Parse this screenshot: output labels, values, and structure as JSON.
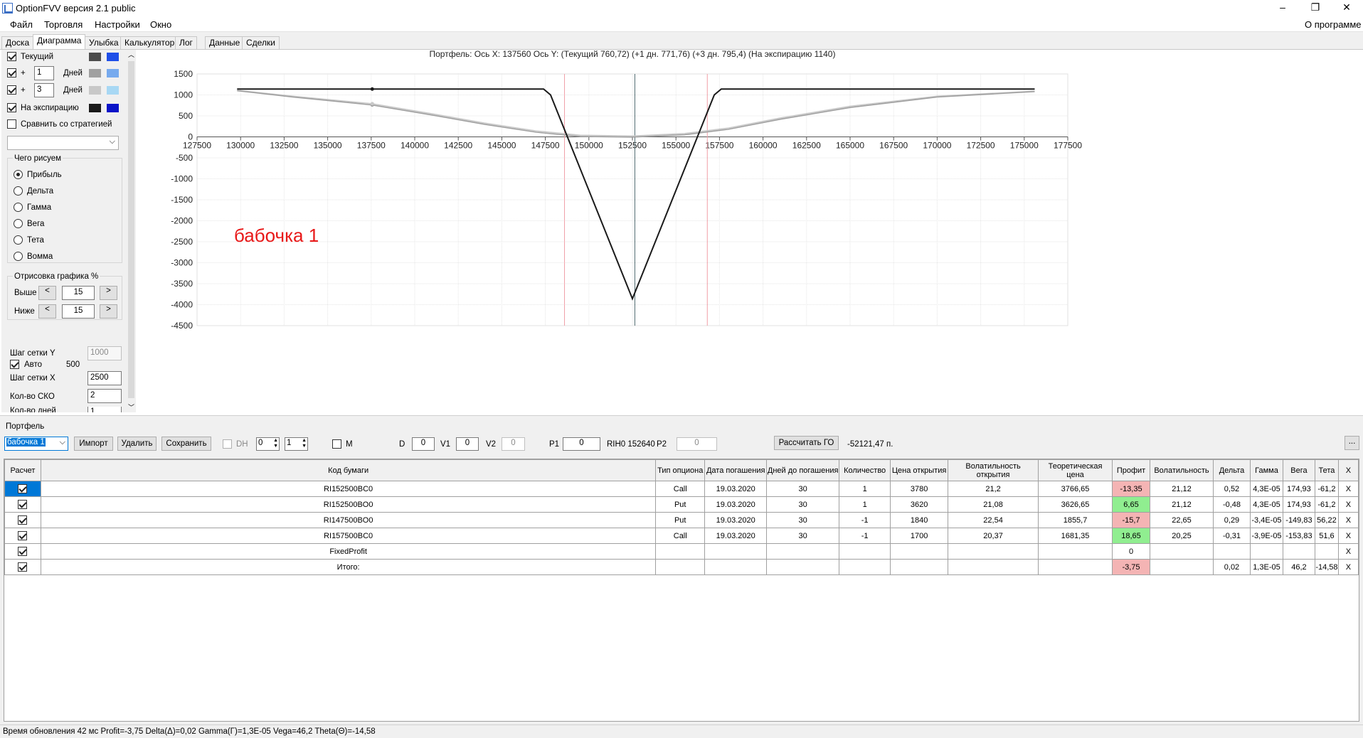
{
  "window": {
    "title": "OptionFVV версия 2.1 public",
    "minimize": "–",
    "maximize": "❐",
    "close": "✕"
  },
  "menu": {
    "items": [
      "Файл",
      "Торговля",
      "Настройки",
      "Окно"
    ],
    "about": "О программе"
  },
  "tabs": [
    "Доска",
    "Диаграмма",
    "Улыбка",
    "Калькулятор",
    "Лог",
    "Данные",
    "Сделки"
  ],
  "left": {
    "curves": [
      {
        "label": "Текущий",
        "checked": true,
        "c1": "#4d4d4d",
        "c2": "#1f4fe8"
      },
      {
        "label": "+",
        "days": "1",
        "unit": "Дней",
        "checked": true,
        "c1": "#a0a0a0",
        "c2": "#77aaee"
      },
      {
        "label": "+",
        "days": "3",
        "unit": "Дней",
        "checked": true,
        "c1": "#c8c8c8",
        "c2": "#a8d8f4"
      },
      {
        "label": "На экспирацию",
        "checked": true,
        "c1": "#1a1a1a",
        "c2": "#0a14c8"
      }
    ],
    "compare": "Сравнить со стратегией",
    "what_title": "Чего рисуем",
    "what": [
      "Прибыль",
      "Дельта",
      "Гамма",
      "Вега",
      "Тета",
      "Вомма"
    ],
    "draw_title": "Отрисовка графика %",
    "above": "Выше",
    "below": "Ниже",
    "above_val": "15",
    "below_val": "15",
    "prev": "<",
    "next": ">",
    "gridy": "Шаг сетки Y",
    "gridy_val": "1000",
    "auto": "Авто",
    "auto_val": "500",
    "gridx": "Шаг сетки X",
    "gridx_val": "2500",
    "sko": "Кол-во СКО",
    "sko_val": "2",
    "days": "Кол-во дней",
    "days_val": "1"
  },
  "chart_data": {
    "type": "line",
    "title": "Портфель:  Ось X:  137560  Ось Y:   (Текущий 760,72)   (+1 дн.  771,76)   (+3 дн.  795,4)   (На экспирацию  1140)",
    "annotation": "бабочка 1",
    "xlim": [
      127500,
      177500
    ],
    "ylim": [
      -4500,
      1500
    ],
    "xticks": [
      127500,
      130000,
      132500,
      135000,
      137500,
      140000,
      142500,
      145000,
      147500,
      150000,
      152500,
      155000,
      157500,
      160000,
      162500,
      165000,
      167500,
      170000,
      172500,
      175000,
      177500
    ],
    "yticks": [
      1500,
      1000,
      500,
      0,
      -500,
      -1000,
      -1500,
      -2000,
      -2500,
      -3000,
      -3500,
      -4000,
      -4500
    ],
    "cursor_x": 137560,
    "vlines": {
      "current": 152640,
      "break_low": 148600,
      "break_high": 156800
    },
    "series": [
      {
        "x": [
          129800,
          147400,
          147800,
          152500,
          157200,
          157600,
          175600
        ],
        "y": [
          1140,
          1140,
          1000,
          -3860,
          1000,
          1140,
          1140
        ],
        "color": "#1a1a1a"
      },
      {
        "x": [
          129800,
          133000,
          137560,
          141000,
          144000,
          147000,
          149500,
          152500,
          155500,
          158000,
          161000,
          165000,
          170000,
          175600
        ],
        "y": [
          1100,
          950,
          760,
          520,
          300,
          110,
          10,
          -5,
          50,
          180,
          420,
          700,
          950,
          1080
        ],
        "color": "#a0a0a0"
      },
      {
        "x": [
          129800,
          133000,
          137560,
          141000,
          144000,
          147000,
          149500,
          152500,
          155500,
          158000,
          161000,
          165000,
          170000,
          175600
        ],
        "y": [
          1110,
          970,
          790,
          550,
          330,
          140,
          40,
          20,
          80,
          210,
          450,
          730,
          970,
          1090
        ],
        "color": "#c8c8c8"
      }
    ]
  },
  "portfolio": {
    "section": "Портфель",
    "name": "бабочка 1",
    "import": "Импорт",
    "delete": "Удалить",
    "save": "Сохранить",
    "dh": "DH",
    "dh1": "0",
    "dh2": "1",
    "m": "M",
    "d": "D",
    "d_val": "0",
    "v1": "V1",
    "v1_val": "0",
    "v2": "V2",
    "v2_val": "0",
    "p1": "P1",
    "p1_val": "0",
    "rih": "RIH0 152640",
    "p2": "P2",
    "p2_val": "0",
    "go_btn": "Рассчитать ГО",
    "go_val": "-52121,47 п.",
    "dots": "..."
  },
  "table": {
    "headers": [
      "Расчет",
      "Код бумаги",
      "Тип опциона",
      "Дата погашения",
      "Дней до погашения",
      "Количество",
      "Цена открытия",
      "Волатильность открытия",
      "Теоретическая цена",
      "Профит",
      "Волатильность",
      "Дельта",
      "Гамма",
      "Вега",
      "Тета",
      "X"
    ],
    "rows": [
      [
        "RI152500BC0",
        "Call",
        "19.03.2020",
        "30",
        "1",
        "3780",
        "21,2",
        "3766,65",
        "-13,35",
        "21,12",
        "0,52",
        "4,3E-05",
        "174,93",
        "-61,2",
        "X"
      ],
      [
        "RI152500BO0",
        "Put",
        "19.03.2020",
        "30",
        "1",
        "3620",
        "21,08",
        "3626,65",
        "6,65",
        "21,12",
        "-0,48",
        "4,3E-05",
        "174,93",
        "-61,2",
        "X"
      ],
      [
        "RI147500BO0",
        "Put",
        "19.03.2020",
        "30",
        "-1",
        "1840",
        "22,54",
        "1855,7",
        "-15,7",
        "22,65",
        "0,29",
        "-3,4E-05",
        "-149,83",
        "56,22",
        "X"
      ],
      [
        "RI157500BC0",
        "Call",
        "19.03.2020",
        "30",
        "-1",
        "1700",
        "20,37",
        "1681,35",
        "18,65",
        "20,25",
        "-0,31",
        "-3,9E-05",
        "-153,83",
        "51,6",
        "X"
      ],
      [
        "FixedProfit",
        "",
        "",
        "",
        "",
        "",
        "",
        "",
        "0",
        "",
        "",
        "",
        "",
        "",
        "X"
      ],
      [
        "Итого:",
        "",
        "",
        "",
        "",
        "",
        "",
        "",
        "-3,75",
        "",
        "0,02",
        "1,3E-05",
        "46,2",
        "-14,58",
        "X"
      ]
    ],
    "profit_class": [
      "neg",
      "pos",
      "neg",
      "pos",
      "",
      "neg"
    ]
  },
  "status": "Время обновления 42 мс   Profit=-3,75 Delta(Δ)=0,02 Gamma(Γ)=1,3E-05 Vega=46,2 Theta(Θ)=-14,58"
}
